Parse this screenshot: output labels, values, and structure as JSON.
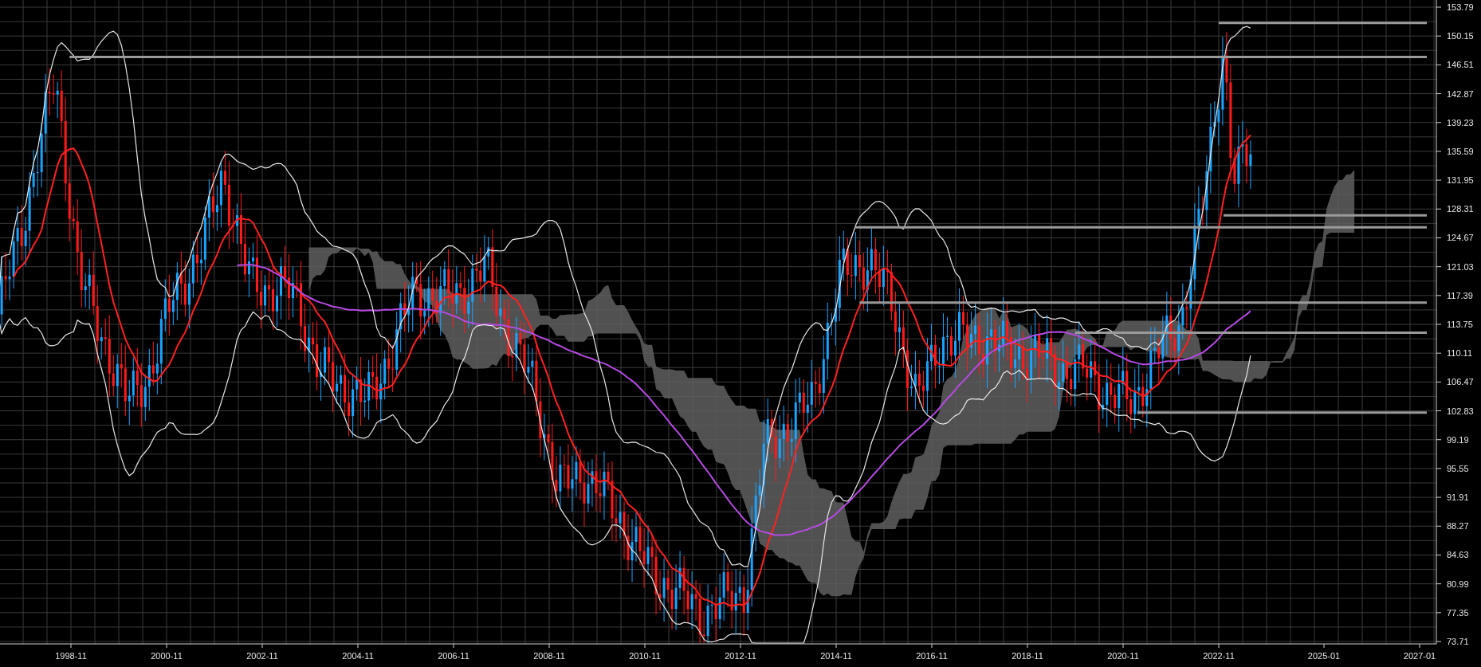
{
  "y_axis": {
    "labels": [
      "153.79",
      "150.15",
      "146.51",
      "142.87",
      "139.23",
      "135.59",
      "131.95",
      "128.31",
      "124.67",
      "121.03",
      "117.39",
      "113.75",
      "110.11",
      "106.47",
      "102.83",
      "99.19",
      "95.55",
      "91.91",
      "88.27",
      "84.63",
      "80.99",
      "77.35",
      "73.71"
    ]
  },
  "x_axis": {
    "labels": [
      "1998-11",
      "2000-11",
      "2002-11",
      "2004-11",
      "2006-11",
      "2008-11",
      "2010-11",
      "2012-11",
      "2014-11",
      "2016-11",
      "2018-11",
      "2020-11",
      "2022-11",
      "2025-01",
      "2027-01"
    ]
  }
}
